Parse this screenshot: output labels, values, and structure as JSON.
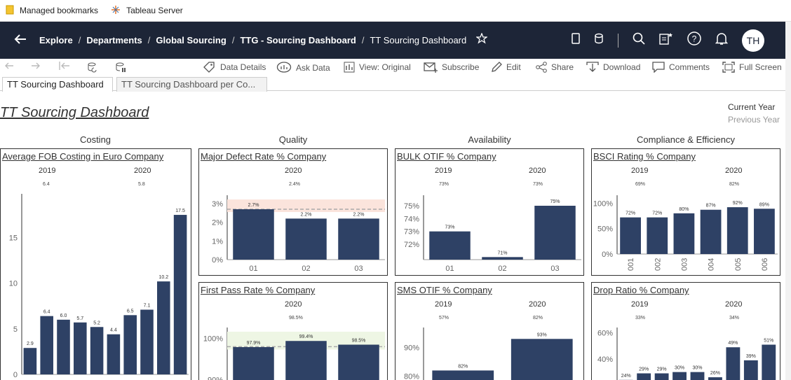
{
  "bookmarks": [
    {
      "label": "Managed bookmarks"
    },
    {
      "label": "Tableau Server"
    }
  ],
  "breadcrumbs": [
    "Explore",
    "Departments",
    "Global Sourcing",
    "TTG - Sourcing Dashboard",
    "TT Sourcing Dashboard"
  ],
  "user": {
    "initials": "TH"
  },
  "toolbar": [
    "Data Details",
    "Ask Data",
    "View: Original",
    "Subscribe",
    "Edit",
    "Share",
    "Download",
    "Comments",
    "Full Screen"
  ],
  "tabs": [
    "TT Sourcing Dashboard",
    "TT Sourcing Dashboard per Co..."
  ],
  "dashboard": {
    "title": "TT Sourcing Dashboard",
    "legend": {
      "current": "Current Year",
      "previous": "Previous Year"
    },
    "sections": [
      "Costing",
      "Quality",
      "Availability",
      "Compliance & Efficiency"
    ]
  },
  "colors": {
    "bar": "#2e4165",
    "topbar": "#1d2537"
  },
  "chart_data": [
    {
      "type": "bar",
      "title": "Average FOB Costing in Euro Company",
      "years": [
        "2019",
        "2020"
      ],
      "year_values": [
        "6.4",
        "5.8"
      ],
      "categories": [
        "",
        "",
        "",
        "",
        "",
        "",
        "",
        "",
        "",
        "",
        ""
      ],
      "values": [
        2.9,
        6.4,
        6.0,
        5.7,
        5.2,
        4.4,
        6.5,
        7.1,
        10.2,
        17.5
      ],
      "labels": [
        "2.9",
        "6.4",
        "6.0",
        "5.7",
        "5.2",
        "4.4",
        "6.5",
        "7.1",
        "10.2",
        "17.5"
      ],
      "yticks": [
        "0",
        "5",
        "10",
        "15"
      ],
      "ylim": [
        0,
        19.5
      ]
    },
    {
      "type": "bar",
      "title": "Major Defect Rate % Company",
      "years": [
        "2020"
      ],
      "year_values": [
        "2.4%"
      ],
      "categories": [
        "01",
        "02",
        "03"
      ],
      "values": [
        2.7,
        2.2,
        2.2
      ],
      "labels": [
        "2.7%",
        "2.2%",
        "2.2%"
      ],
      "yticks": [
        "0%",
        "1%",
        "2%",
        "3%"
      ],
      "ylim": [
        0,
        3.3
      ],
      "target": 2.7
    },
    {
      "type": "bar",
      "title": "BULK OTIF % Company",
      "years": [
        "2019",
        "2020"
      ],
      "year_values": [
        "73%",
        "73%"
      ],
      "categories": [
        "01",
        "02",
        "03"
      ],
      "values": [
        73,
        71,
        75
      ],
      "labels": [
        "73%",
        "71%",
        "75%"
      ],
      "yticks": [
        "72%",
        "73%",
        "74%",
        "75%"
      ],
      "ylim": [
        70.8,
        75.6
      ]
    },
    {
      "type": "bar",
      "title": "BSCI Rating % Company",
      "years": [
        "2019",
        "2020"
      ],
      "year_values": [
        "69%",
        "82%"
      ],
      "categories": [
        "001",
        "002",
        "003",
        "004",
        "005",
        "006"
      ],
      "values": [
        72,
        72,
        80,
        87,
        92,
        89
      ],
      "labels": [
        "72%",
        "72%",
        "80%",
        "87%",
        "92%",
        "89%"
      ],
      "yticks": [
        "0%",
        "50%",
        "100%"
      ],
      "ylim": [
        0,
        110
      ]
    },
    {
      "type": "bar",
      "title": "First Pass Rate % Company",
      "years": [
        "2020"
      ],
      "year_values": [
        "98.5%"
      ],
      "categories": [
        "",
        "",
        ""
      ],
      "values": [
        97.9,
        99.4,
        98.5
      ],
      "labels": [
        "97.9%",
        "99.4%",
        "98.5%"
      ],
      "yticks": [
        "90%",
        "100%"
      ],
      "ylim": [
        88,
        102
      ],
      "target": 98.0
    },
    {
      "type": "bar",
      "title": "SMS OTIF % Company",
      "years": [
        "2019",
        "2020"
      ],
      "year_values": [
        "57%",
        "82%"
      ],
      "categories": [
        "",
        ""
      ],
      "values": [
        82,
        93
      ],
      "labels": [
        "82%",
        "93%"
      ],
      "yticks": [
        "80%",
        "90%"
      ],
      "ylim": [
        76,
        96
      ]
    },
    {
      "type": "bar",
      "title": "Drop Ratio % Company",
      "years": [
        "2019",
        "2020"
      ],
      "year_values": [
        "33%",
        "34%"
      ],
      "categories": [
        "",
        "",
        "",
        "",
        "",
        "",
        "",
        "",
        ""
      ],
      "values": [
        24,
        29,
        29,
        30,
        30,
        26,
        49,
        39,
        51
      ],
      "labels": [
        "24%",
        "29%",
        "29%",
        "30%",
        "30%",
        "26%",
        "49%",
        "39%",
        "51%"
      ],
      "yticks": [
        "20%",
        "40%",
        "60%"
      ],
      "ylim": [
        18,
        62
      ]
    }
  ]
}
